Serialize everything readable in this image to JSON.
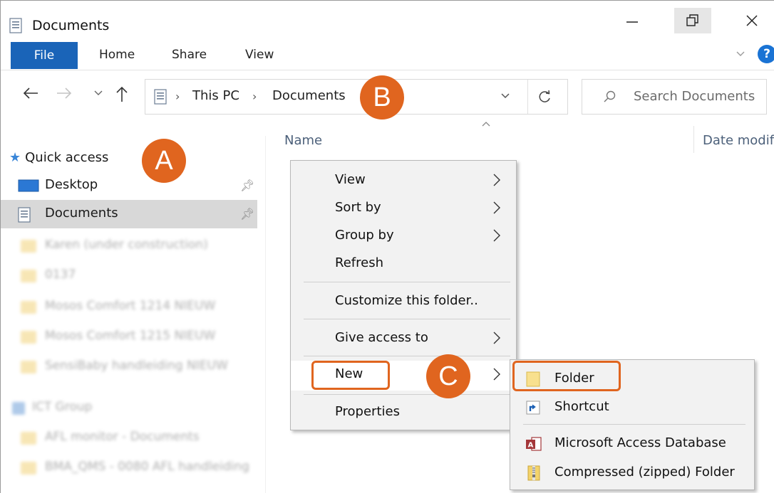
{
  "window": {
    "title": "Documents"
  },
  "ribbon": {
    "tabs": [
      "File",
      "Home",
      "Share",
      "View"
    ]
  },
  "navigation": {
    "breadcrumb": [
      "This PC",
      "Documents"
    ],
    "search_placeholder": "Search Documents"
  },
  "sidebar": {
    "quick_access_label": "Quick access",
    "items": [
      {
        "label": "Desktop",
        "pinned": true,
        "selected": false
      },
      {
        "label": "Documents",
        "pinned": true,
        "selected": true
      }
    ],
    "blurred_items": [
      "Karen (under construction)",
      "0137",
      "Mosos Comfort 1214 NIEUW",
      "Mosos Comfort 1215 NIEUW",
      "SensiBaby handleiding NIEUW",
      "ICT Group",
      "AFL monitor - Documents",
      "BMA_QMS - 0080 AFL handleiding"
    ]
  },
  "content": {
    "columns": {
      "name": "Name",
      "date": "Date modif"
    }
  },
  "context_menu": {
    "items": [
      {
        "label": "View",
        "submenu": true
      },
      {
        "label": "Sort by",
        "submenu": true
      },
      {
        "label": "Group by",
        "submenu": true
      },
      {
        "label": "Refresh",
        "submenu": false
      },
      {
        "label": "Customize this folder..",
        "submenu": false
      },
      {
        "label": "Give access to",
        "submenu": true
      },
      {
        "label": "New",
        "submenu": true
      },
      {
        "label": "Properties",
        "submenu": false
      }
    ]
  },
  "new_submenu": {
    "items": [
      {
        "label": "Folder",
        "icon": "folder-icon"
      },
      {
        "label": "Shortcut",
        "icon": "shortcut-icon"
      },
      {
        "label": "Microsoft Access Database",
        "icon": "access-database-icon"
      },
      {
        "label": "Compressed (zipped) Folder",
        "icon": "zip-folder-icon"
      }
    ]
  },
  "callouts": {
    "a": "A",
    "b": "B",
    "c": "C"
  },
  "colors": {
    "accent": "#e0651f",
    "file_tab": "#1a64b8",
    "help": "#1a73d4"
  }
}
